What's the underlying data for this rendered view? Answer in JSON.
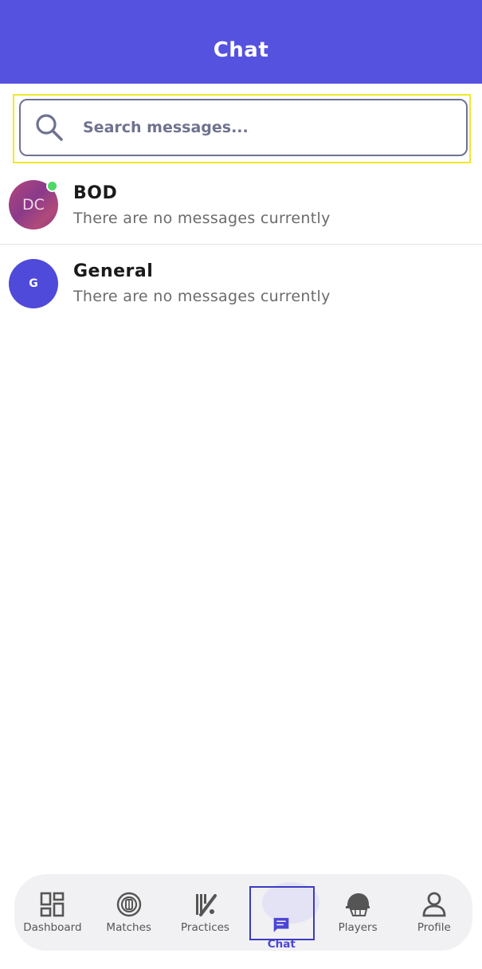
{
  "header": {
    "title": "Chat"
  },
  "search": {
    "placeholder": "Search messages..."
  },
  "chats": [
    {
      "initials": "DC",
      "name": "BOD",
      "preview": "There are no messages currently",
      "online": true
    },
    {
      "initials": "G",
      "name": "General",
      "preview": "There are no messages currently",
      "online": false
    }
  ],
  "nav": {
    "items": [
      {
        "label": "Dashboard",
        "icon": "dashboard-icon"
      },
      {
        "label": "Matches",
        "icon": "matches-icon"
      },
      {
        "label": "Practices",
        "icon": "practices-icon"
      },
      {
        "label": "Chat",
        "icon": "chat-icon",
        "active": true
      },
      {
        "label": "Players",
        "icon": "players-icon"
      },
      {
        "label": "Profile",
        "icon": "profile-icon"
      }
    ]
  },
  "colors": {
    "header_bg": "#5552df",
    "accent": "#4b47d6",
    "online": "#4cd964",
    "highlight": "#f0e92a"
  }
}
